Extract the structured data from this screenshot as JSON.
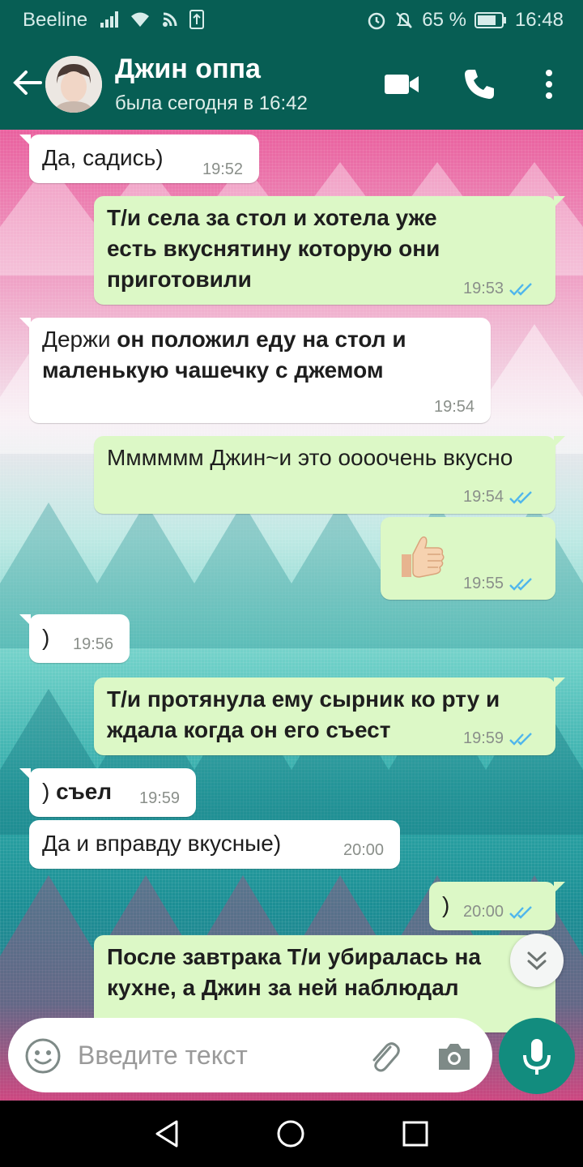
{
  "status_bar": {
    "carrier": "Beeline",
    "battery": "65 %",
    "time": "16:48"
  },
  "header": {
    "contact_name": "Джин оппа",
    "last_seen": "была сегодня в 16:42"
  },
  "messages": [
    {
      "dir": "in",
      "text": "Да, садись)",
      "time": "19:52"
    },
    {
      "dir": "out",
      "bold": "Т/и села за стол и хотела уже есть вкуснятину которую они приготовили",
      "time": "19:53",
      "read": true
    },
    {
      "dir": "in",
      "text": "Держи ",
      "bold": "он положил еду на стол и маленькую чашечку с джемом",
      "time": "19:54"
    },
    {
      "dir": "out",
      "text": "Мммммм Джин~и это оооочень вкусно",
      "time": "19:54",
      "read": true
    },
    {
      "dir": "out",
      "emoji": "thumbs-up",
      "time": "19:55",
      "read": true
    },
    {
      "dir": "in",
      "text": ")",
      "time": "19:56"
    },
    {
      "dir": "out",
      "bold": "Т/и протянула ему сырник ко рту и ждала когда он его съест",
      "time": "19:59",
      "read": true
    },
    {
      "dir": "in",
      "text": ") ",
      "bold": "съел",
      "time": "19:59"
    },
    {
      "dir": "in",
      "text": "Да и вправду вкусные)",
      "time": "20:00"
    },
    {
      "dir": "out",
      "text": ")",
      "time": "20:00",
      "read": true
    },
    {
      "dir": "out",
      "bold": "После завтрака Т/и убиралась на кухне, а Джин за ней наблюдал"
    }
  ],
  "input": {
    "placeholder": "Введите текст"
  },
  "colors": {
    "header": "#075e54",
    "incoming": "#ffffff",
    "outgoing": "#dcf8c6",
    "read_ticks": "#4fb6ec",
    "mic_button": "#128c7e"
  }
}
